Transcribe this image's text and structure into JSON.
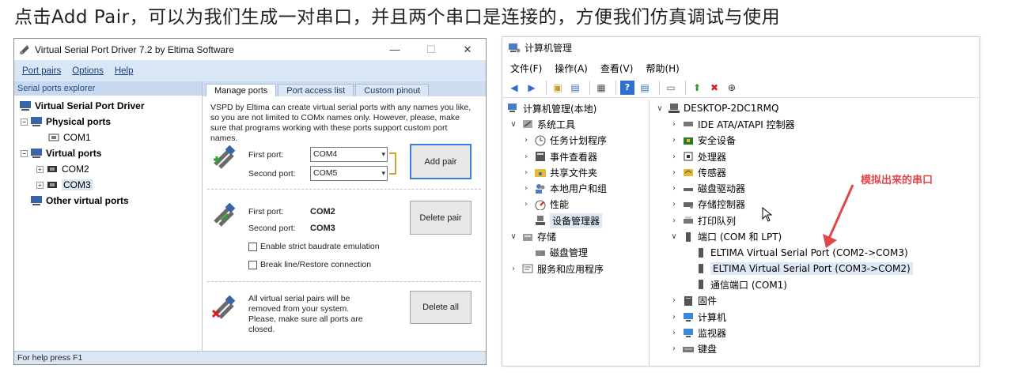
{
  "caption": "点击Add Pair，可以为我们生成一对串口，并且两个串口是连接的，方便我们仿真调试与使用",
  "vspd": {
    "title": "Virtual Serial Port Driver 7.2 by Eltima Software",
    "menu": [
      "Port pairs",
      "Options",
      "Help"
    ],
    "explorer_header": "Serial ports explorer",
    "tree": {
      "root": "Virtual Serial Port Driver",
      "physical": "Physical ports",
      "com1": "COM1",
      "virtual": "Virtual ports",
      "com2": "COM2",
      "com3": "COM3",
      "other": "Other virtual ports"
    },
    "tabs": [
      "Manage ports",
      "Port access list",
      "Custom pinout"
    ],
    "description": "VSPD by Eltima can create virtual serial ports with any names you like, so you are not limited to COMx names only. However, please, make sure that programs working with these ports support custom port names.",
    "add": {
      "first_label": "First port:",
      "first_value": "COM4",
      "second_label": "Second port:",
      "second_value": "COM5",
      "button": "Add pair"
    },
    "delete": {
      "first_label": "First port:",
      "first_value": "COM2",
      "second_label": "Second port:",
      "second_value": "COM3",
      "button": "Delete pair",
      "check1": "Enable strict baudrate emulation",
      "check2": "Break line/Restore connection"
    },
    "delete_all": {
      "text": "All virtual serial pairs will be removed from your system. Please, make sure all ports are closed.",
      "button": "Delete all"
    },
    "status": "For help press F1"
  },
  "cm": {
    "title": "计算机管理",
    "menu": [
      "文件(F)",
      "操作(A)",
      "查看(V)",
      "帮助(H)"
    ],
    "left": {
      "root": "计算机管理(本地)",
      "system_tools": "系统工具",
      "task_scheduler": "任务计划程序",
      "event_viewer": "事件查看器",
      "shared_folders": "共享文件夹",
      "local_users": "本地用户和组",
      "performance": "性能",
      "device_manager": "设备管理器",
      "storage": "存储",
      "disk_mgmt": "磁盘管理",
      "services": "服务和应用程序"
    },
    "right": {
      "computer": "DESKTOP-2DC1RMQ",
      "ide": "IDE ATA/ATAPI 控制器",
      "security": "安全设备",
      "processor": "处理器",
      "sensor": "传感器",
      "disk_drives": "磁盘驱动器",
      "storage_ctrl": "存储控制器",
      "print_queue": "打印队列",
      "ports": "端口 (COM 和 LPT)",
      "port1": "ELTIMA Virtual Serial Port (COM2->COM3)",
      "port2": "ELTIMA Virtual Serial Port (COM3->COM2)",
      "port3": "通信端口 (COM1)",
      "firmware": "固件",
      "computer_node": "计算机",
      "monitor": "监视器",
      "keyboard": "键盘"
    }
  },
  "annotation": "模拟出来的串口",
  "colors": {
    "accent": "#3b7fd6",
    "annotation": "#e04848",
    "explorer_header": "#c8d9ef"
  }
}
